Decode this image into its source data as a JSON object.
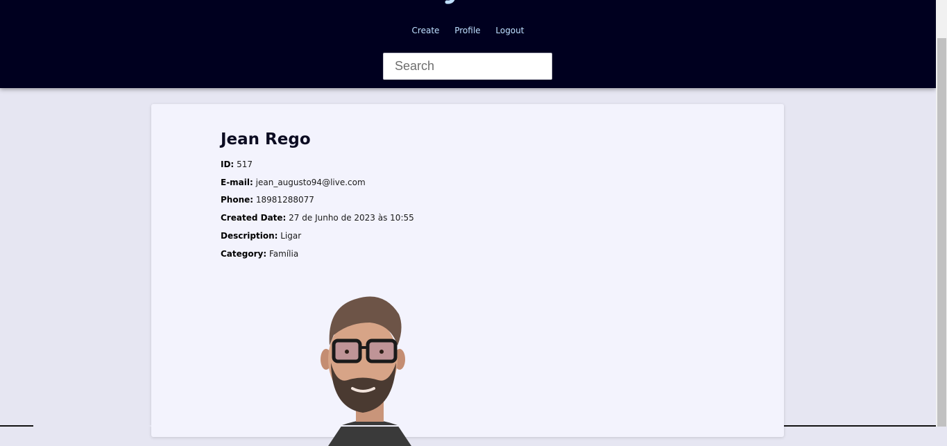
{
  "nav": {
    "create": "Create",
    "profile": "Profile",
    "logout": "Logout"
  },
  "search": {
    "placeholder": "Search"
  },
  "contact": {
    "name": "Jean Rego",
    "fields": {
      "id": {
        "label": "ID:",
        "value": "517"
      },
      "email": {
        "label": "E-mail:",
        "value": "jean_augusto94@live.com"
      },
      "phone": {
        "label": "Phone:",
        "value": "18981288077"
      },
      "created": {
        "label": "Created Date:",
        "value": "27 de Junho de 2023 às 10:55"
      },
      "description": {
        "label": "Description:",
        "value": "Ligar"
      },
      "category": {
        "label": "Category:",
        "value": "Família"
      }
    }
  },
  "colors": {
    "header_bg": "#00001f",
    "nav_link": "#bfe0ff",
    "page_bg": "#e6e6f2",
    "card_bg": "#f3f3fd"
  }
}
